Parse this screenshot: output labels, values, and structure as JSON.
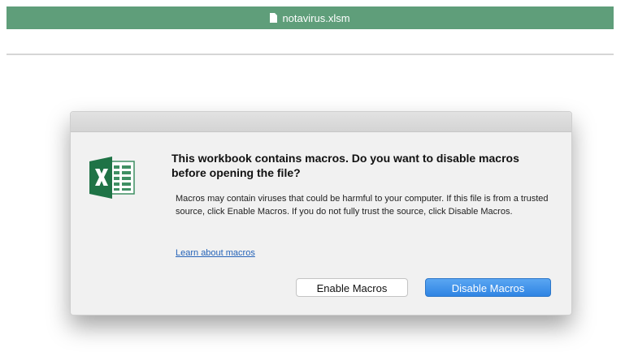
{
  "window": {
    "title": "notavirus.xlsm",
    "icon": "document-icon",
    "titlebar_color": "#5f9e7a"
  },
  "dialog": {
    "icon": "excel-icon",
    "question": "This workbook contains macros. Do you want to disable macros before opening the file?",
    "details": "Macros may contain viruses that could be harmful to your computer. If this file is from a trusted source, click Enable Macros. If you do not fully trust the source, click Disable Macros.",
    "learn_link": "Learn about macros",
    "buttons": {
      "enable": "Enable Macros",
      "disable": "Disable Macros"
    },
    "default_button_color": "#3b8ee8"
  }
}
